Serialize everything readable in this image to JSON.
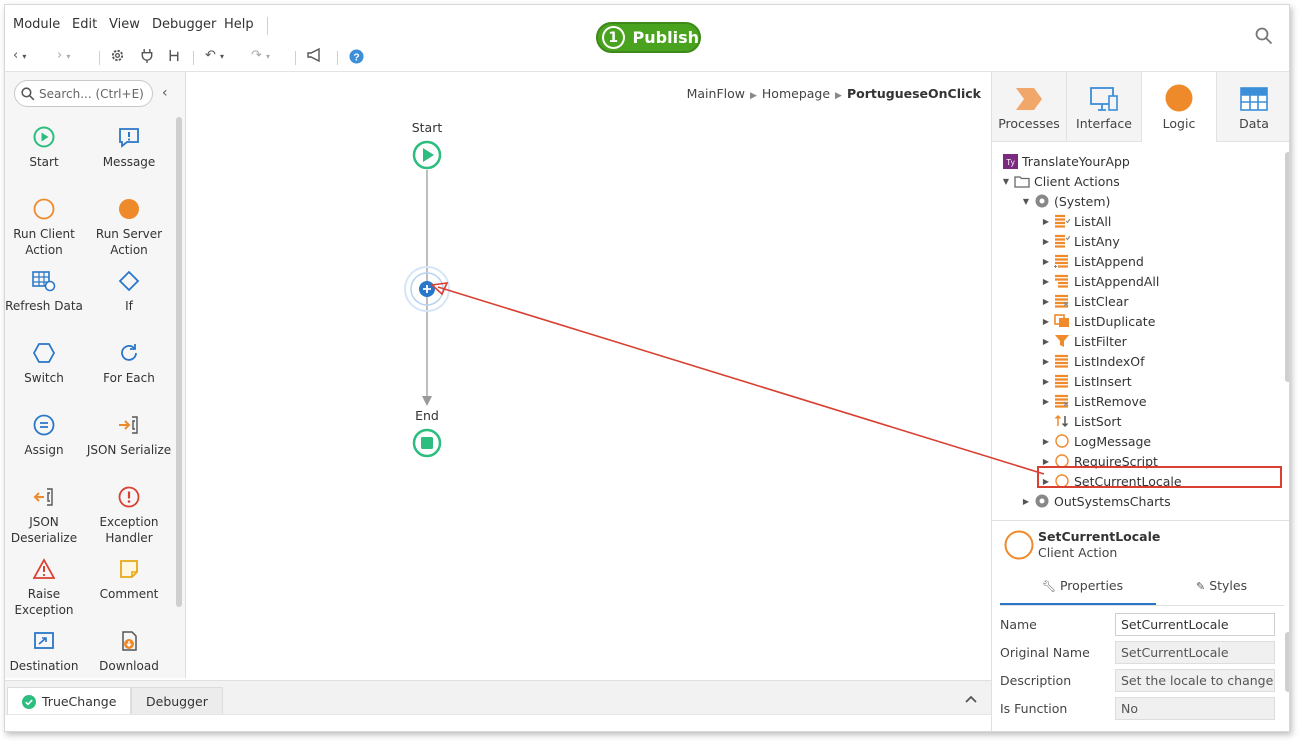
{
  "menu": [
    "Module",
    "Edit",
    "View",
    "Debugger",
    "Help"
  ],
  "publish": {
    "count": "1",
    "label": "Publish"
  },
  "toolbox": {
    "search_placeholder": "Search... (Ctrl+E)",
    "tools": [
      {
        "label": "Start"
      },
      {
        "label": "Message"
      },
      {
        "label": "Run Client Action"
      },
      {
        "label": "Run Server Action"
      },
      {
        "label": "Refresh Data"
      },
      {
        "label": "If"
      },
      {
        "label": "Switch"
      },
      {
        "label": "For Each"
      },
      {
        "label": "Assign"
      },
      {
        "label": "JSON Serialize"
      },
      {
        "label": "JSON Deserialize"
      },
      {
        "label": "Exception Handler"
      },
      {
        "label": "Raise Exception"
      },
      {
        "label": "Comment"
      },
      {
        "label": "Destination"
      },
      {
        "label": "Download"
      }
    ]
  },
  "breadcrumb": {
    "items": [
      "MainFlow",
      "Homepage"
    ],
    "current": "PortugueseOnClick"
  },
  "flow": {
    "start_label": "Start",
    "end_label": "End"
  },
  "bottom_tabs": [
    "TrueChange",
    "Debugger"
  ],
  "right_tabs": [
    "Processes",
    "Interface",
    "Logic",
    "Data"
  ],
  "tree": {
    "app": "TranslateYourApp",
    "folder": "Client Actions",
    "system": "(System)",
    "actions": [
      "ListAll",
      "ListAny",
      "ListAppend",
      "ListAppendAll",
      "ListClear",
      "ListDuplicate",
      "ListFilter",
      "ListIndexOf",
      "ListInsert",
      "ListRemove",
      "ListSort",
      "LogMessage",
      "RequireScript",
      "SetCurrentLocale"
    ],
    "next": "OutSystemsCharts"
  },
  "detail": {
    "title": "SetCurrentLocale",
    "subtitle": "Client Action"
  },
  "prop_tabs": {
    "properties": "Properties",
    "styles": "Styles"
  },
  "properties": [
    {
      "label": "Name",
      "value": "SetCurrentLocale"
    },
    {
      "label": "Original Name",
      "value": "SetCurrentLocale"
    },
    {
      "label": "Description",
      "value": "Set the locale to change ..."
    },
    {
      "label": "Is Function",
      "value": "No"
    }
  ],
  "colors": {
    "publish": "#4aa31e",
    "start_end": "#2dbd7e",
    "orange": "#ef8a2b",
    "highlight": "#d94032",
    "accent_blue": "#2a77c9"
  }
}
